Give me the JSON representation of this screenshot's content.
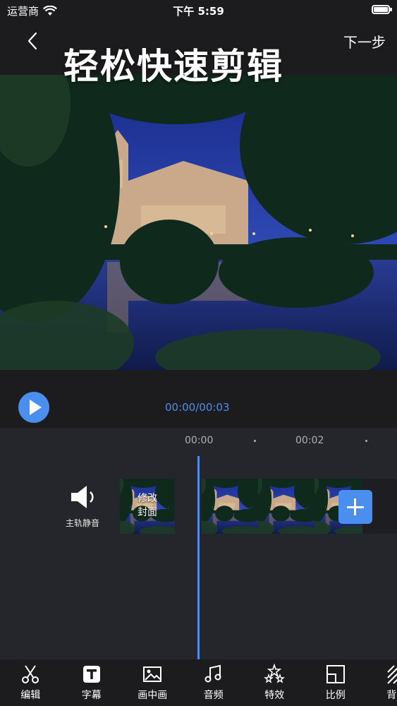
{
  "status_bar": {
    "carrier": "运营商",
    "time": "下午 5:59"
  },
  "nav": {
    "next_label": "下一步"
  },
  "overlay_title": "轻松快速剪辑",
  "player": {
    "time_readout": "00:00/00:03"
  },
  "timeline": {
    "ruler_labels": [
      "00:00",
      "00:02"
    ],
    "mute_label": "主轨静音",
    "cover_label_line1": "修改",
    "cover_label_line2": "封面"
  },
  "toolbar": {
    "items": [
      {
        "label": "编辑",
        "icon": "scissors-icon"
      },
      {
        "label": "字幕",
        "icon": "text-icon"
      },
      {
        "label": "画中画",
        "icon": "image-icon"
      },
      {
        "label": "音频",
        "icon": "music-icon"
      },
      {
        "label": "特效",
        "icon": "sparkle-icon"
      },
      {
        "label": "比例",
        "icon": "ratio-icon"
      },
      {
        "label": "背景",
        "icon": "background-icon"
      }
    ]
  },
  "colors": {
    "accent": "#4a8ef0",
    "background": "#1c1c1e",
    "timeline_bg": "#25262b"
  }
}
